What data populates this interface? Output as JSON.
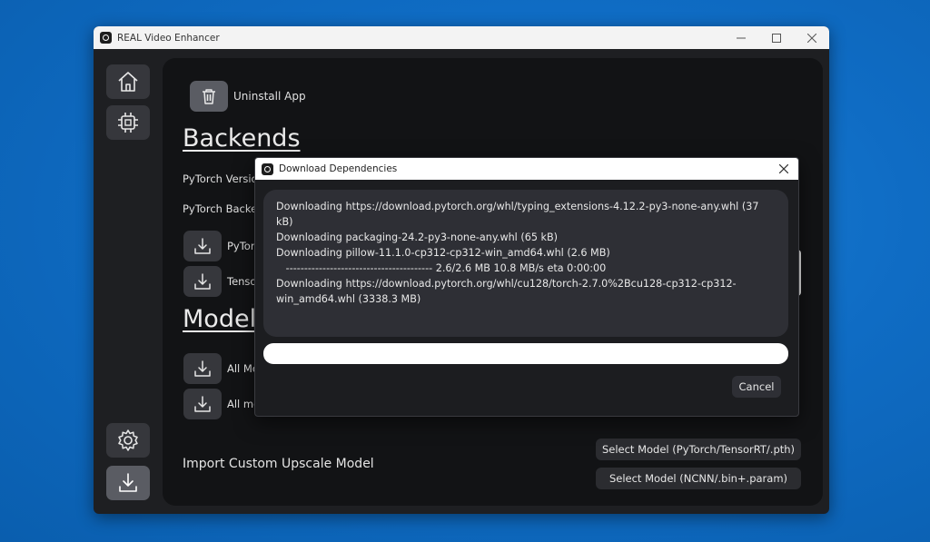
{
  "window": {
    "title": "REAL Video Enhancer",
    "minimize": "—",
    "maximize": "☐",
    "close": "✕"
  },
  "sidebar": {
    "items": [
      {
        "name": "home",
        "icon": "home-icon"
      },
      {
        "name": "processor",
        "icon": "chip-icon"
      },
      {
        "name": "settings",
        "icon": "gear-icon"
      },
      {
        "name": "download",
        "icon": "download-icon",
        "active": true
      }
    ]
  },
  "main": {
    "uninstall_label": "Uninstall App",
    "backends_heading": "Backends",
    "pytorch_version_label": "PyTorch Versio",
    "pytorch_backend_label": "PyTorch Backe",
    "pytorch_download_label": "PyTorc",
    "tensorrt_download_label": "Tenso",
    "models_heading": "Model",
    "all_models_label_1": "All Mo",
    "all_models_label_2": "All mo",
    "import_custom_label": "Import Custom Upscale Model",
    "select_pytorch_model": "Select Model (PyTorch/TensorRT/.pth)",
    "select_ncnn_model": "Select Model (NCNN/.bin+.param)"
  },
  "dialog": {
    "title": "Download Dependencies",
    "close": "✕",
    "log_lines": [
      "Downloading https://download.pytorch.org/whl/typing_extensions-4.12.2-py3-none-any.whl (37 kB)",
      "Downloading packaging-24.2-py3-none-any.whl (65 kB)",
      "Downloading pillow-11.1.0-cp312-cp312-win_amd64.whl (2.6 MB)",
      "   ---------------------------------------- 2.6/2.6 MB 10.8 MB/s eta 0:00:00",
      "Downloading https://download.pytorch.org/whl/cu128/torch-2.7.0%2Bcu128-cp312-cp312-win_amd64.whl (3338.3 MB)"
    ],
    "progress_fraction": 0,
    "cancel_label": "Cancel"
  }
}
